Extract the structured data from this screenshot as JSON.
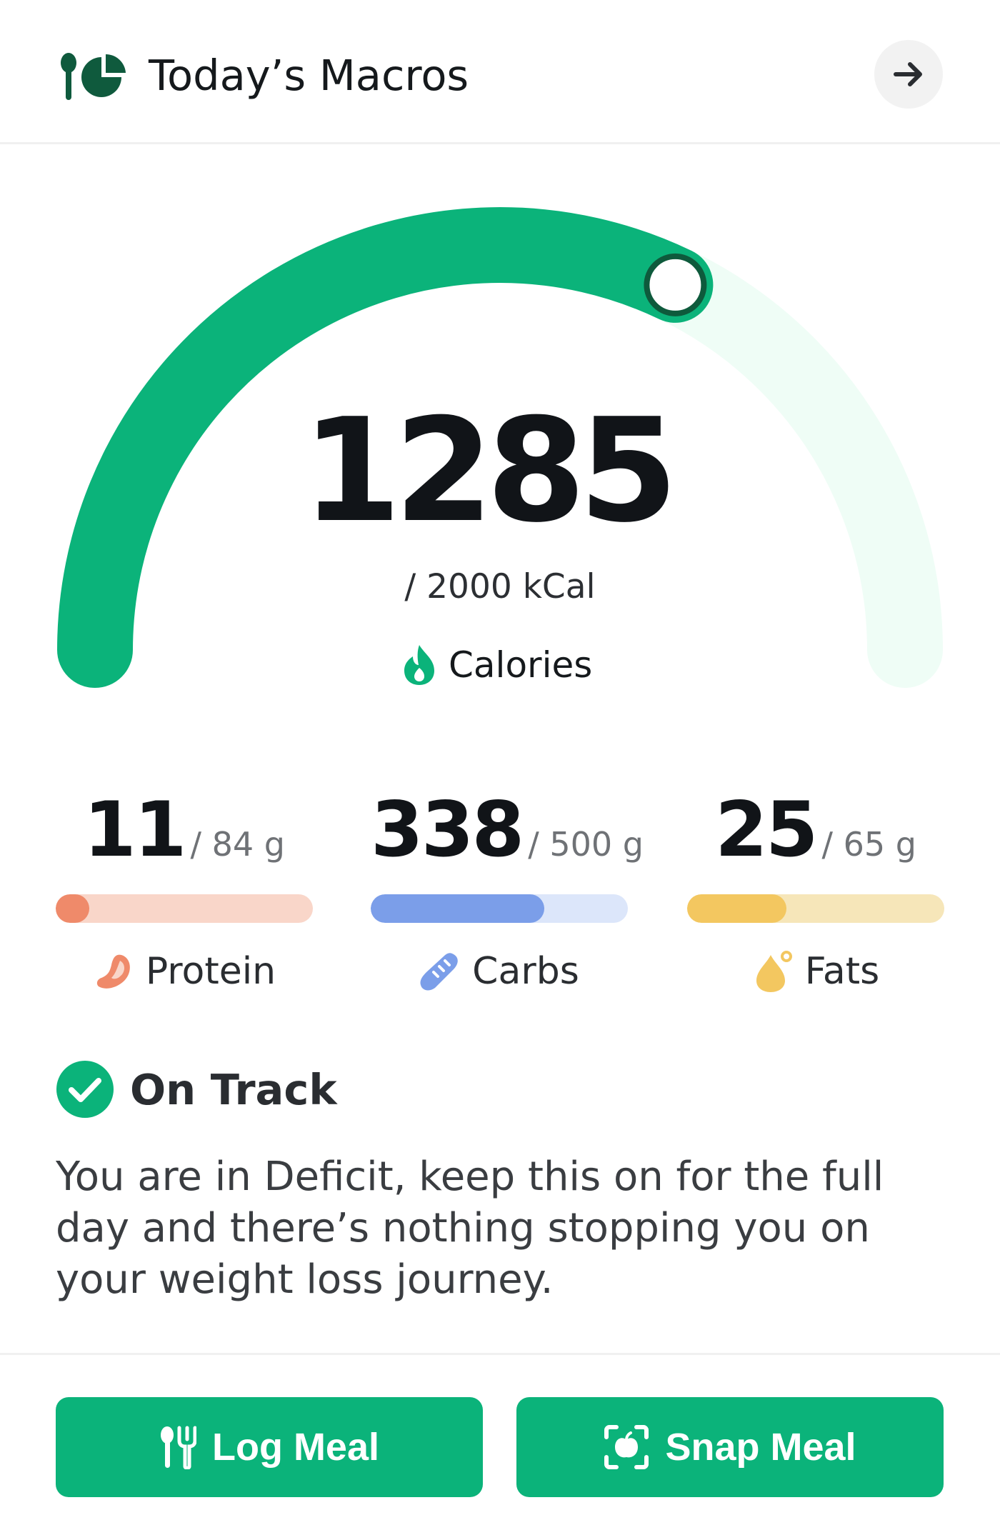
{
  "header": {
    "title": "Today’s Macros",
    "icon": "fork-pie-chart-icon",
    "nav_icon": "arrow-right-icon"
  },
  "calories": {
    "value": "1285",
    "goal": "/ 2000 kCal",
    "label": "Calories",
    "progress_fraction": 0.6425,
    "icon": "flame-icon"
  },
  "macros": [
    {
      "name": "Protein",
      "value": "11",
      "goal": "/ 84 g",
      "progress": 0.131,
      "icon": "meat-icon",
      "fill_color": "#ef8a6a",
      "track_color": "#f9d6c9"
    },
    {
      "name": "Carbs",
      "value": "338",
      "goal": "/ 500 g",
      "progress": 0.676,
      "icon": "bread-icon",
      "fill_color": "#7b9ee9",
      "track_color": "#dce6fa"
    },
    {
      "name": "Fats",
      "value": "25",
      "goal": "/ 65 g",
      "progress": 0.385,
      "icon": "oil-drop-icon",
      "fill_color": "#f3c760",
      "track_color": "#f6e6b9"
    }
  ],
  "status": {
    "title": "On Track",
    "message": "You are in Deficit, keep this on for the full day and there’s nothing stopping you on your weight loss journey.",
    "icon": "check-circle-icon"
  },
  "actions": {
    "log_meal": "Log Meal",
    "snap_meal": "Snap Meal",
    "log_icon": "fork-knife-icon",
    "snap_icon": "camera-scan-icon"
  },
  "colors": {
    "primary": "#0bb37a",
    "primary_light": "#effdf6",
    "knob_ring": "#0e5a3c"
  }
}
